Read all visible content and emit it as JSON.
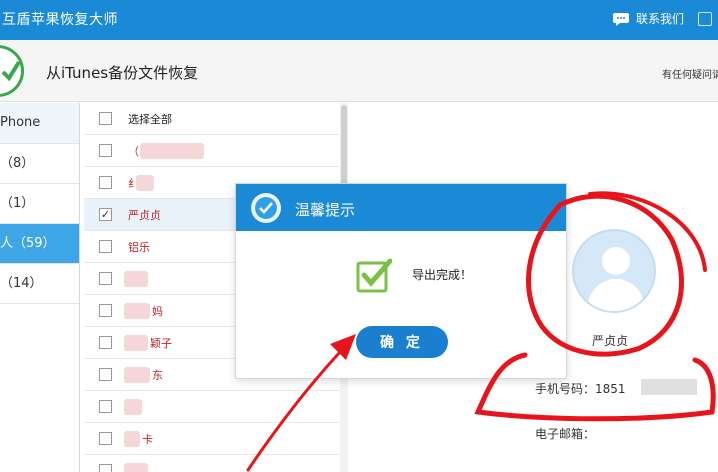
{
  "app": {
    "title": "互盾苹果恢复大师",
    "contact_label": "联系我们"
  },
  "header": {
    "title": "从iTunes备份文件恢复",
    "help_text": "有任何疑问请"
  },
  "sidebar": {
    "items": [
      {
        "label": "Phone"
      },
      {
        "label": "（8）"
      },
      {
        "label": "（1）"
      },
      {
        "label": "人（59）"
      },
      {
        "label": "（14）"
      }
    ]
  },
  "list": {
    "select_all_label": "选择全部",
    "rows": [
      {
        "name": "（",
        "checked": false
      },
      {
        "name": "纟",
        "checked": false
      },
      {
        "name": "严贞贞",
        "checked": true
      },
      {
        "name": "铝乐",
        "checked": false
      },
      {
        "name": "",
        "checked": false
      },
      {
        "name": "妈",
        "checked": false
      },
      {
        "name": "颖子",
        "checked": false
      },
      {
        "name": "东",
        "checked": false
      },
      {
        "name": "",
        "checked": false
      },
      {
        "name": "卡",
        "checked": false
      },
      {
        "name": "",
        "checked": false
      }
    ]
  },
  "detail": {
    "name": "严贞贞",
    "phone_label": "手机号码：1851",
    "email_label": "电子邮箱："
  },
  "dialog": {
    "title": "温馨提示",
    "message": "导出完成！",
    "ok_label": "确 定"
  },
  "colors": {
    "primary": "#1b8ad6",
    "active_sidebar": "#3ea6e6",
    "annotation": "#e8141b",
    "check_green": "#7ac143"
  }
}
